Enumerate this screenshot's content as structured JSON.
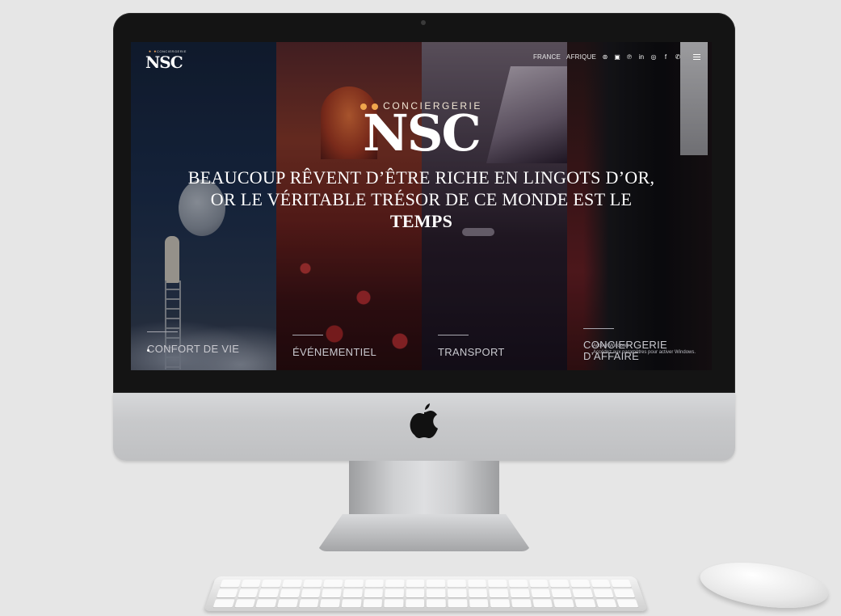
{
  "site": {
    "logo": {
      "dots": "● ●",
      "sub": "CONCIERGERIE",
      "word": "NSC"
    },
    "nav": {
      "links": [
        "FRANCE",
        "AFRIQUE"
      ],
      "icons": [
        "tripadvisor-icon",
        "basket-icon",
        "pinterest-icon",
        "linkedin-icon",
        "instagram-icon",
        "facebook-icon",
        "whatsapp-icon"
      ],
      "icon_glyphs": [
        "⊛",
        "▣",
        "℗",
        "in",
        "◎",
        "f",
        "✆"
      ]
    },
    "hero": {
      "subtitle": "CONCIERGERIE",
      "brand": "NSC",
      "quote_line1": "BEAUCOUP RÊVENT D’ÊTRE RICHE EN LINGOTS D’OR,",
      "quote_line2": "OR LE VÉRITABLE TRÉSOR DE CE MONDE EST LE",
      "quote_line3": "TEMPS"
    },
    "categories": [
      {
        "label": "CONFORT DE VIE"
      },
      {
        "label": "ÉVÉNEMENTIEL"
      },
      {
        "label": "TRANSPORT"
      },
      {
        "label": "CONCIERGERIE D’AFFAIRE"
      }
    ],
    "windows_watermark": {
      "line1": "Activer Windows",
      "line2": "Accédez aux paramètres pour activer Windows."
    }
  },
  "colors": {
    "accent": "#f0a64d",
    "background": "#e6e6e6"
  }
}
